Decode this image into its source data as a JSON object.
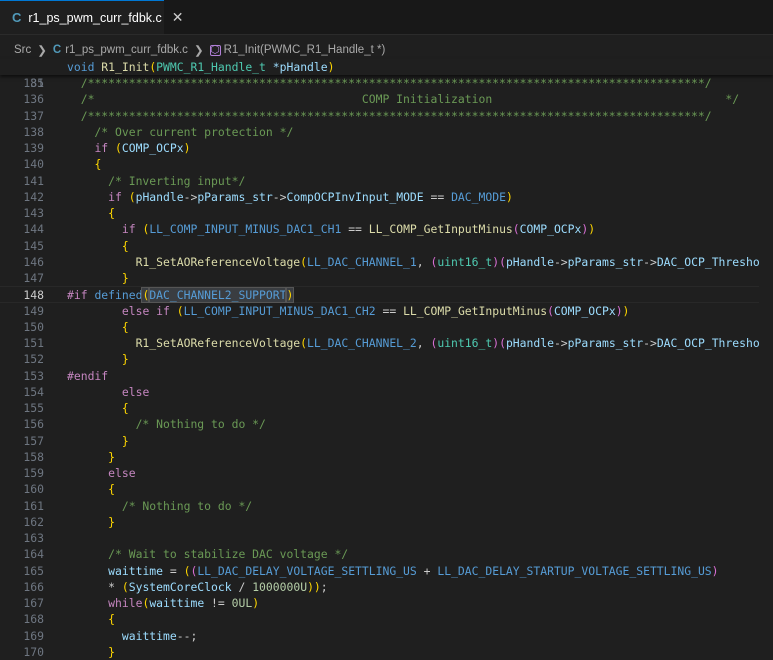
{
  "tab": {
    "icon": "C",
    "title": "r1_ps_pwm_curr_fdbk.c",
    "close": "✕"
  },
  "breadcrumb": {
    "folder": "Src",
    "file_icon": "C",
    "file": "r1_ps_pwm_curr_fdbk.c",
    "symbol": "R1_Init(PWMC_R1_Handle_t *)"
  },
  "sticky": {
    "line_number": "81",
    "code": "void R1_Init(PWMC_R1_Handle_t *pHandle)"
  },
  "active_line": "148",
  "lines": [
    {
      "n": "135",
      "t": "  /******************************************************************************************/"
    },
    {
      "n": "136",
      "t": "  /*                                       COMP Initialization                                  */"
    },
    {
      "n": "137",
      "t": "  /******************************************************************************************/"
    },
    {
      "n": "138",
      "t": "    /* Over current protection */"
    },
    {
      "n": "139",
      "t": "    if (COMP_OCPx)"
    },
    {
      "n": "140",
      "t": "    {"
    },
    {
      "n": "141",
      "t": "      /* Inverting input*/"
    },
    {
      "n": "142",
      "t": "      if (pHandle->pParams_str->CompOCPInvInput_MODE == DAC_MODE)"
    },
    {
      "n": "143",
      "t": "      {"
    },
    {
      "n": "144",
      "t": "        if (LL_COMP_INPUT_MINUS_DAC1_CH1 == LL_COMP_GetInputMinus(COMP_OCPx))"
    },
    {
      "n": "145",
      "t": "        {"
    },
    {
      "n": "146",
      "t": "          R1_SetAOReferenceVoltage(LL_DAC_CHANNEL_1, (uint16_t)(pHandle->pParams_str->DAC_OCP_Threshold));"
    },
    {
      "n": "147",
      "t": "        }"
    },
    {
      "n": "148",
      "t": "#if defined(DAC_CHANNEL2_SUPPORT)"
    },
    {
      "n": "149",
      "t": "        else if (LL_COMP_INPUT_MINUS_DAC1_CH2 == LL_COMP_GetInputMinus(COMP_OCPx))"
    },
    {
      "n": "150",
      "t": "        {"
    },
    {
      "n": "151",
      "t": "          R1_SetAOReferenceVoltage(LL_DAC_CHANNEL_2, (uint16_t)(pHandle->pParams_str->DAC_OCP_Threshold));"
    },
    {
      "n": "152",
      "t": "        }"
    },
    {
      "n": "153",
      "t": "#endif"
    },
    {
      "n": "154",
      "t": "        else"
    },
    {
      "n": "155",
      "t": "        {"
    },
    {
      "n": "156",
      "t": "          /* Nothing to do */"
    },
    {
      "n": "157",
      "t": "        }"
    },
    {
      "n": "158",
      "t": "      }"
    },
    {
      "n": "159",
      "t": "      else"
    },
    {
      "n": "160",
      "t": "      {"
    },
    {
      "n": "161",
      "t": "        /* Nothing to do */"
    },
    {
      "n": "162",
      "t": "      }"
    },
    {
      "n": "163",
      "t": ""
    },
    {
      "n": "164",
      "t": "      /* Wait to stabilize DAC voltage */"
    },
    {
      "n": "165",
      "t": "      waittime = ((LL_DAC_DELAY_VOLTAGE_SETTLING_US + LL_DAC_DELAY_STARTUP_VOLTAGE_SETTLING_US)"
    },
    {
      "n": "166",
      "t": "      * (SystemCoreClock / 1000000U));"
    },
    {
      "n": "167",
      "t": "      while(waittime != 0UL)"
    },
    {
      "n": "168",
      "t": "      {"
    },
    {
      "n": "169",
      "t": "        waittime--;"
    },
    {
      "n": "170",
      "t": "      }"
    }
  ],
  "colors": {
    "background": "#1f1f1f",
    "tab_accent": "#0078d4",
    "comment": "#6a9955",
    "keyword": "#c586c0",
    "function": "#dcdcaa",
    "variable": "#9cdcfe",
    "type": "#4ec9b0"
  }
}
